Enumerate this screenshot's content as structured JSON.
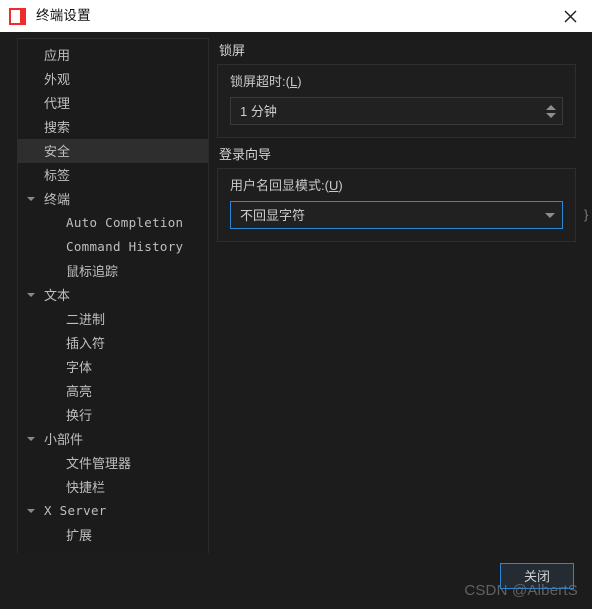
{
  "window": {
    "title": "终端设置",
    "app_icon": "terminal-app-icon",
    "close_icon": "close-icon"
  },
  "sidebar": {
    "items": [
      {
        "label": "应用",
        "level": 0,
        "expandable": false,
        "selected": false,
        "mono": false
      },
      {
        "label": "外观",
        "level": 0,
        "expandable": false,
        "selected": false,
        "mono": false
      },
      {
        "label": "代理",
        "level": 0,
        "expandable": false,
        "selected": false,
        "mono": false
      },
      {
        "label": "搜索",
        "level": 0,
        "expandable": false,
        "selected": false,
        "mono": false
      },
      {
        "label": "安全",
        "level": 0,
        "expandable": false,
        "selected": true,
        "mono": false
      },
      {
        "label": "标签",
        "level": 0,
        "expandable": false,
        "selected": false,
        "mono": false
      },
      {
        "label": "终端",
        "level": 0,
        "expandable": true,
        "selected": false,
        "mono": false
      },
      {
        "label": "Auto Completion",
        "level": 1,
        "expandable": false,
        "selected": false,
        "mono": true
      },
      {
        "label": "Command History",
        "level": 1,
        "expandable": false,
        "selected": false,
        "mono": true
      },
      {
        "label": "鼠标追踪",
        "level": 1,
        "expandable": false,
        "selected": false,
        "mono": false
      },
      {
        "label": "文本",
        "level": 0,
        "expandable": true,
        "selected": false,
        "mono": false
      },
      {
        "label": "二进制",
        "level": 1,
        "expandable": false,
        "selected": false,
        "mono": false
      },
      {
        "label": "插入符",
        "level": 1,
        "expandable": false,
        "selected": false,
        "mono": false
      },
      {
        "label": "字体",
        "level": 1,
        "expandable": false,
        "selected": false,
        "mono": false
      },
      {
        "label": "高亮",
        "level": 1,
        "expandable": false,
        "selected": false,
        "mono": false
      },
      {
        "label": "换行",
        "level": 1,
        "expandable": false,
        "selected": false,
        "mono": false
      },
      {
        "label": "小部件",
        "level": 0,
        "expandable": true,
        "selected": false,
        "mono": false
      },
      {
        "label": "文件管理器",
        "level": 1,
        "expandable": false,
        "selected": false,
        "mono": false
      },
      {
        "label": "快捷栏",
        "level": 1,
        "expandable": false,
        "selected": false,
        "mono": false
      },
      {
        "label": "X Server",
        "level": 0,
        "expandable": true,
        "selected": false,
        "mono": true
      },
      {
        "label": "扩展",
        "level": 1,
        "expandable": false,
        "selected": false,
        "mono": false
      }
    ]
  },
  "content": {
    "groups": [
      {
        "title": "锁屏",
        "field_label_text": "锁屏超时:(",
        "field_label_mnemonic": "L",
        "field_label_tail": ")",
        "control": "spinbox",
        "value": "1 分钟"
      },
      {
        "title": "登录向导",
        "field_label_text": "用户名回显模式:(",
        "field_label_mnemonic": "U",
        "field_label_tail": ")",
        "control": "combobox",
        "value": "不回显字符"
      }
    ],
    "edge_sliver": "}"
  },
  "footer": {
    "close_label": "关闭",
    "watermark": "CSDN @AlbertS"
  },
  "colors": {
    "accent": "#2b86d6",
    "window_bg": "#1c1c1c",
    "titlebar_bg": "#ffffff",
    "icon_red": "#ef2b2b",
    "selected_row": "#2e2e2e",
    "text": "#c9c9c9"
  }
}
